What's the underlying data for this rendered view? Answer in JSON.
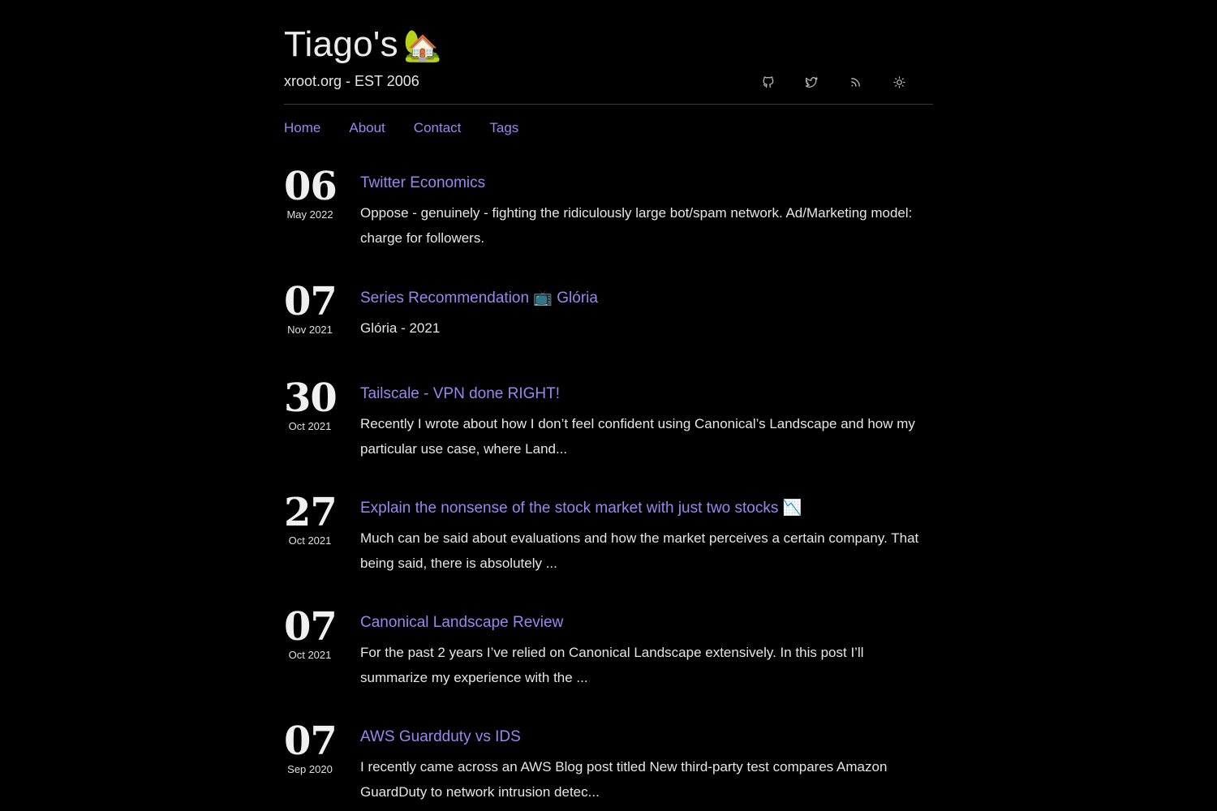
{
  "site": {
    "title": "Tiago's",
    "title_emoji": "🏡",
    "subtitle": "xroot.org - EST 2006"
  },
  "header_icons": [
    "github-icon",
    "twitter-icon",
    "rss-icon",
    "theme-toggle-icon"
  ],
  "nav": [
    {
      "label": "Home"
    },
    {
      "label": "About"
    },
    {
      "label": "Contact"
    },
    {
      "label": "Tags"
    }
  ],
  "colors": {
    "background": "#000000",
    "accent": "#9b86f0",
    "text": "#ececec"
  },
  "posts": [
    {
      "day": "06",
      "month": "May 2022",
      "title": "Twitter Economics",
      "excerpt": "Oppose - genuinely - fighting the ridiculously large bot/spam network. Ad/Marketing model: charge for followers."
    },
    {
      "day": "07",
      "month": "Nov 2021",
      "title": "Series Recommendation 📺 Glória",
      "excerpt": "Glória - 2021"
    },
    {
      "day": "30",
      "month": "Oct 2021",
      "title": "Tailscale - VPN done RIGHT!",
      "excerpt": "Recently I wrote about how I don’t feel confident using Canonical’s Landscape and how my particular use case, where Land..."
    },
    {
      "day": "27",
      "month": "Oct 2021",
      "title": "Explain the nonsense of the stock market with just two stocks 📉",
      "excerpt": "Much can be said about evaluations and how the market perceives a certain company. That being said, there is absolutely ..."
    },
    {
      "day": "07",
      "month": "Oct 2021",
      "title": "Canonical Landscape Review",
      "excerpt": "For the past 2 years I’ve relied on Canonical Landscape extensively. In this post I’ll summarize my experience with the ..."
    },
    {
      "day": "07",
      "month": "Sep 2020",
      "title": "AWS Guardduty vs IDS",
      "excerpt": "I recently came across an AWS Blog post titled New third-party test compares Amazon GuardDuty to network intrusion detec..."
    }
  ]
}
